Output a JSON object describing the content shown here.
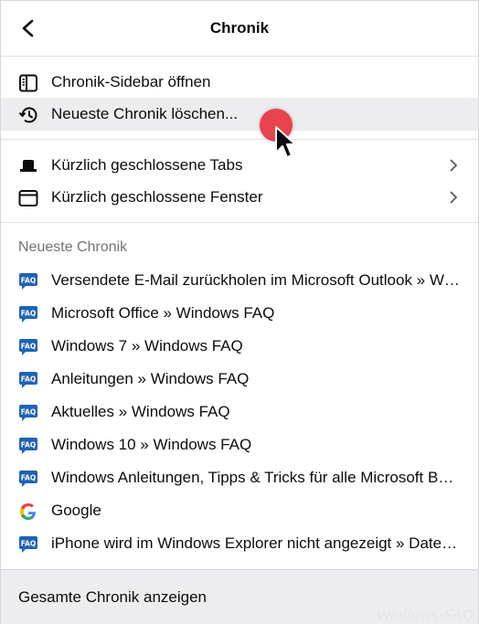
{
  "header": {
    "title": "Chronik",
    "back_icon": "back-arrow-icon"
  },
  "menu": {
    "sidebar_label": "Chronik-Sidebar öffnen",
    "clear_label": "Neueste Chronik löschen...",
    "closed_tabs_label": "Kürzlich geschlossene Tabs",
    "closed_windows_label": "Kürzlich geschlossene Fenster"
  },
  "recent": {
    "heading": "Neueste Chronik",
    "items": [
      {
        "label": "Versendete E-Mail zurückholen im Microsoft Outlook » Windows FAQ",
        "icon": "faq-icon"
      },
      {
        "label": "Microsoft Office » Windows FAQ",
        "icon": "faq-icon"
      },
      {
        "label": "Windows 7 » Windows FAQ",
        "icon": "faq-icon"
      },
      {
        "label": "Anleitungen » Windows FAQ",
        "icon": "faq-icon"
      },
      {
        "label": "Aktuelles » Windows FAQ",
        "icon": "faq-icon"
      },
      {
        "label": "Windows 10 » Windows FAQ",
        "icon": "faq-icon"
      },
      {
        "label": "Windows Anleitungen, Tipps & Tricks für alle Microsoft Betriebssysteme",
        "icon": "faq-icon"
      },
      {
        "label": "Google",
        "icon": "google-icon"
      },
      {
        "label": "iPhone wird im Windows Explorer nicht angezeigt » Datenübertragung",
        "icon": "faq-icon"
      }
    ]
  },
  "footer": {
    "label": "Gesamte Chronik anzeigen"
  },
  "watermark": "Windows-FAQ",
  "colors": {
    "highlight": "#ededf0",
    "cursor_dot": "#e8434e",
    "faq_blue": "#1f63b5"
  }
}
